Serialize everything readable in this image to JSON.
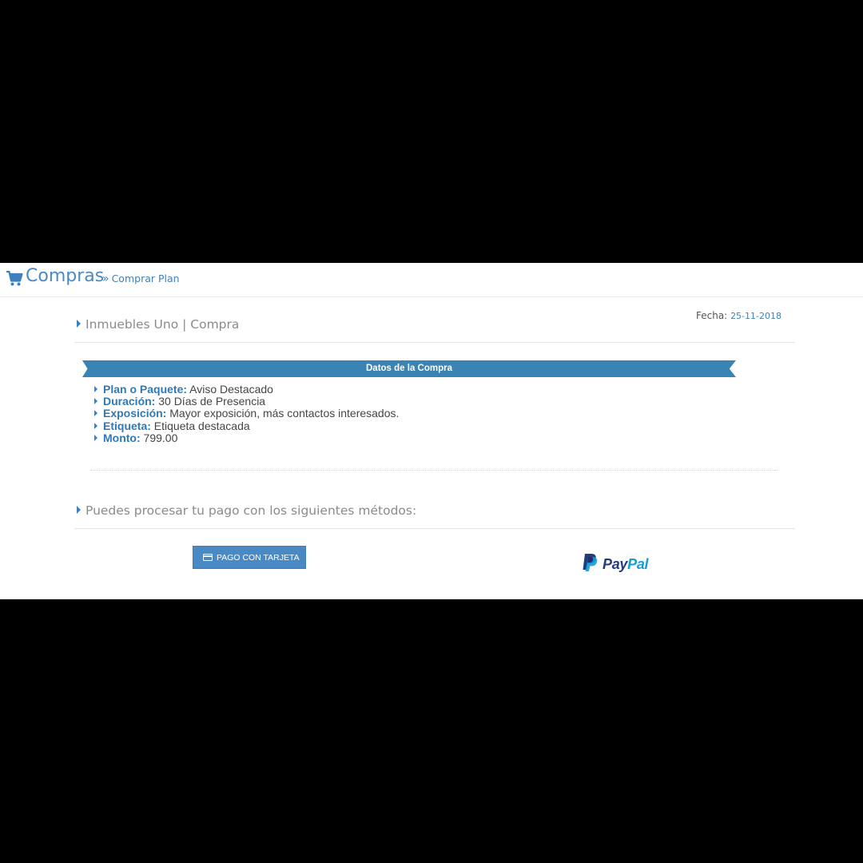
{
  "header": {
    "title": "Compras",
    "breadcrumb_sep": "»",
    "breadcrumb": "Comprar Plan"
  },
  "fecha": {
    "label": "Fecha:",
    "value": "25-11-2018"
  },
  "purchase": {
    "heading": "Inmuebles Uno | Compra",
    "ribbon": "Datos de la Compra",
    "items": [
      {
        "key": "Plan o Paquete:",
        "value": "Aviso Destacado"
      },
      {
        "key": "Duración:",
        "value": "30 Días de Presencia"
      },
      {
        "key": "Exposición:",
        "value": "Mayor exposición, más contactos interesados."
      },
      {
        "key": "Etiqueta:",
        "value": "Etiqueta destacada"
      },
      {
        "key": "Monto:",
        "value": "799.00"
      }
    ]
  },
  "payment": {
    "heading": "Puedes procesar tu pago con los siguientes métodos:",
    "card_button": "PAGO CON TARJETA",
    "paypal": {
      "part1": "Pay",
      "part2": "Pal"
    }
  },
  "colors": {
    "accent": "#3d80bd",
    "ribbon": "#3a84b5",
    "button": "#4a8ac4",
    "paypal_dark": "#253b80",
    "paypal_light": "#179bd7"
  },
  "icons": {
    "header": "cart-icon",
    "card_button": "credit-card-icon",
    "paypal": "paypal-logo-icon"
  }
}
